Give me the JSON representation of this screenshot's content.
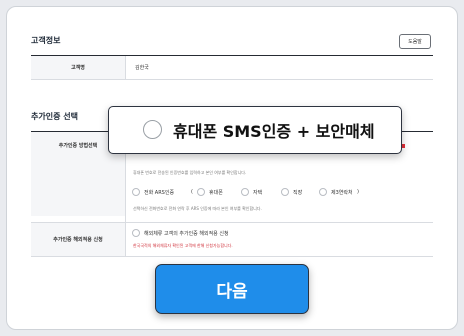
{
  "customer_section": {
    "title": "고객정보",
    "help_button": "도움말",
    "name_label": "고객명",
    "name_value": "김한국"
  },
  "auth_section": {
    "title": "추가인증 선택",
    "method_label": "추가인증 방법선택",
    "phone_note": "휴대폰 번호로 전송된 인증번호를 입력하고 본인 여부를 확인합니다.",
    "ars_options": [
      "전화 ARS인증",
      "휴대폰",
      "자택",
      "직장",
      "제3연락처"
    ],
    "ars_open": "(",
    "ars_close": ")",
    "ars_note": "선택하신 전화번호로 전화 연락 후 ARS 인증에 따라 본인 여부를 확인합니다.",
    "overseas_label": "추가인증 해외적용 신청",
    "overseas_option": "해외체류 고객의 추가인증 해외적용 신청",
    "overseas_note": "한국국적의 해외체류자 확인된 고객에 한해 신청가능합니다."
  },
  "popup": {
    "option_label": "휴대폰 SMS인증 + 보안매체"
  },
  "next_button": "다음",
  "colors": {
    "primary": "#1f8dea",
    "warning": "#d0313b",
    "header_bg": "#f5f6f8"
  }
}
